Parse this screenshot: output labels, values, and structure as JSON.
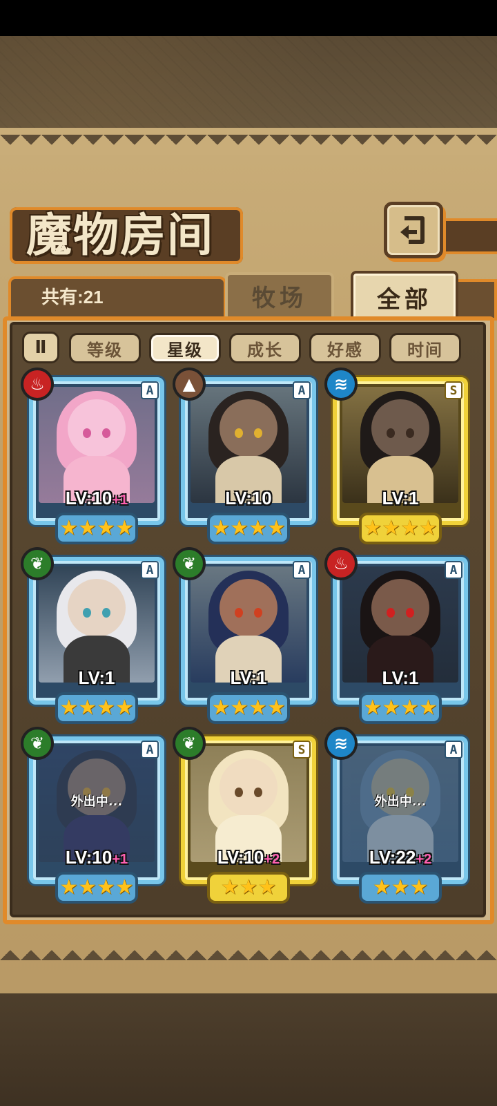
{
  "title": "魔物房间",
  "count_label": "共有:21",
  "tabs": [
    {
      "label": "牧场",
      "active": false
    },
    {
      "label": "全部",
      "active": true
    }
  ],
  "sort_toggle_icon": "pause-sort-icon",
  "filters": [
    {
      "label": "等级",
      "active": false
    },
    {
      "label": "星级",
      "active": true
    },
    {
      "label": "成长",
      "active": false
    },
    {
      "label": "好感",
      "active": false
    },
    {
      "label": "时间",
      "active": false
    }
  ],
  "monsters": [
    {
      "element": "fire",
      "rank": "A",
      "level": "LV:10",
      "bonus": "+1",
      "stars": 4,
      "frame": "blue",
      "away": false,
      "away_label": ""
    },
    {
      "element": "earth",
      "rank": "A",
      "level": "LV:10",
      "bonus": "",
      "stars": 4,
      "frame": "blue",
      "away": false,
      "away_label": ""
    },
    {
      "element": "water",
      "rank": "S",
      "level": "LV:1",
      "bonus": "",
      "stars": 4,
      "frame": "gold",
      "away": false,
      "away_label": ""
    },
    {
      "element": "wood",
      "rank": "A",
      "level": "LV:1",
      "bonus": "",
      "stars": 4,
      "frame": "blue",
      "away": false,
      "away_label": ""
    },
    {
      "element": "wood",
      "rank": "A",
      "level": "LV:1",
      "bonus": "",
      "stars": 4,
      "frame": "blue",
      "away": false,
      "away_label": ""
    },
    {
      "element": "fire",
      "rank": "A",
      "level": "LV:1",
      "bonus": "",
      "stars": 4,
      "frame": "blue",
      "away": false,
      "away_label": ""
    },
    {
      "element": "wood",
      "rank": "A",
      "level": "LV:10",
      "bonus": "+1",
      "stars": 4,
      "frame": "blue",
      "away": true,
      "away_label": "外出中..."
    },
    {
      "element": "wood",
      "rank": "S",
      "level": "LV:10",
      "bonus": "+2",
      "stars": 3,
      "frame": "gold",
      "away": false,
      "away_label": ""
    },
    {
      "element": "water",
      "rank": "A",
      "level": "LV:22",
      "bonus": "+2",
      "stars": 3,
      "frame": "blue",
      "away": true,
      "away_label": "外出中..."
    }
  ],
  "colors": {
    "accent": "#e08a2a",
    "frame_blue": "#78c6ea",
    "frame_gold": "#f0d23a",
    "bonus": "#ff5fb0",
    "fire": "#c82323",
    "water": "#1e86c8",
    "wood": "#2c7d2a",
    "earth": "#7a5138"
  }
}
